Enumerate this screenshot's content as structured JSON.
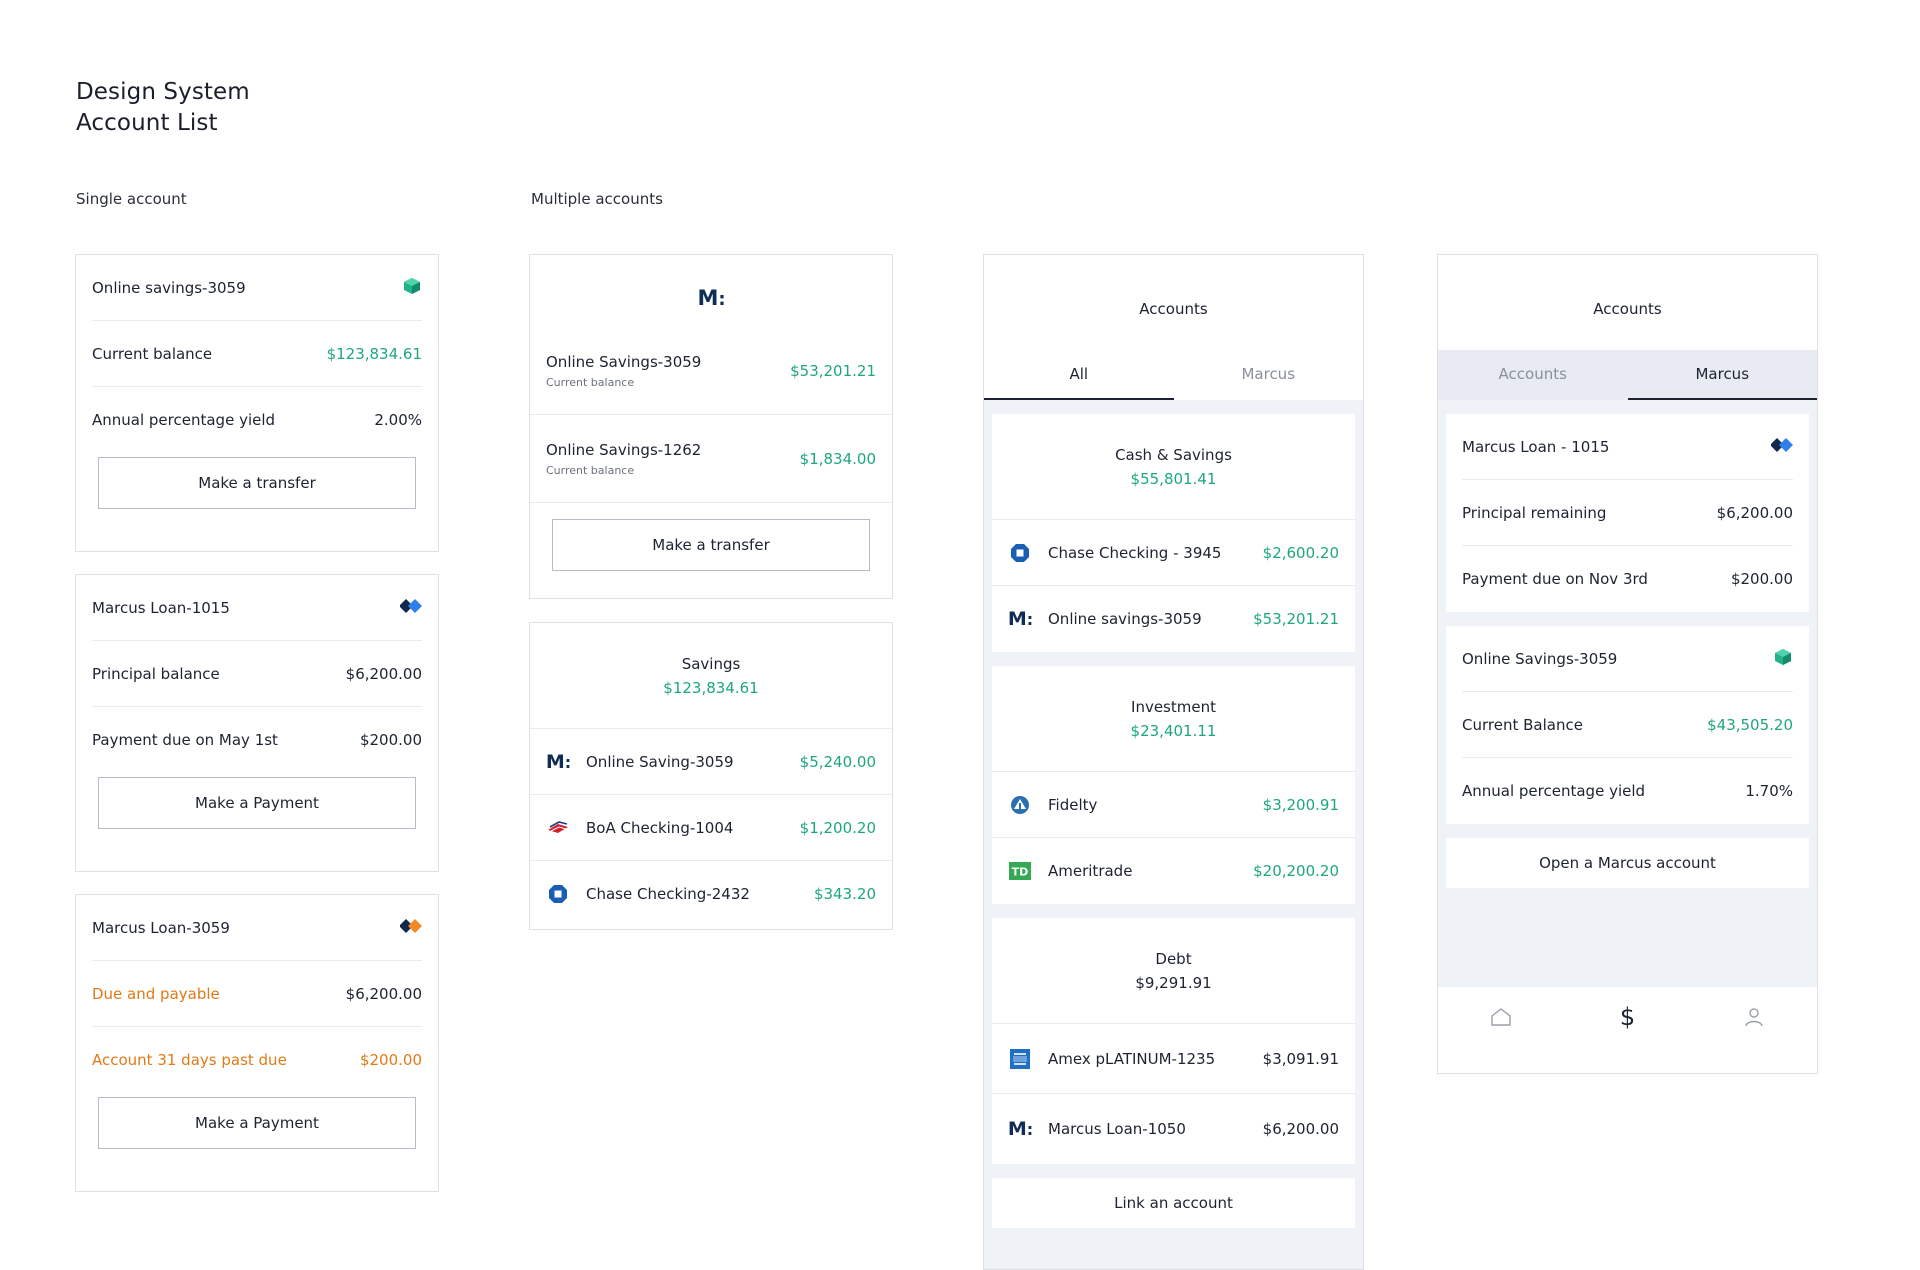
{
  "title": {
    "line1": "Design System",
    "line2": "Account List"
  },
  "sections": {
    "single": "Single account",
    "multiple": "Multiple accounts"
  },
  "colors": {
    "green": "#1ea77f",
    "orange": "#e07a16",
    "navy": "#0f2d55",
    "border": "#dde0e4",
    "panel_bg": "#eff2f6"
  },
  "single": {
    "card1": {
      "title": "Online savings-3059",
      "icon": "marcus-cube-icon",
      "rows": [
        {
          "label": "Current balance",
          "value": "$123,834.61"
        },
        {
          "label": "Annual percentage yield",
          "value": "2.00%"
        }
      ],
      "button": "Make a transfer"
    },
    "card2": {
      "title": "Marcus Loan-1015",
      "icon": "marcus-diamond-icon",
      "rows": [
        {
          "label": "Principal balance",
          "value": "$6,200.00"
        },
        {
          "label": "Payment due on May 1st",
          "value": "$200.00"
        }
      ],
      "button": "Make a Payment"
    },
    "card3": {
      "title": "Marcus Loan-3059",
      "icon": "marcus-diamond-orange-icon",
      "rows": [
        {
          "label": "Due and payable",
          "value": "$6,200.00"
        },
        {
          "label": "Account 31 days past due",
          "value": "$200.00"
        }
      ],
      "button": "Make a Payment"
    }
  },
  "multi": {
    "card1": {
      "logo_letter": "M",
      "logo_colon": ":",
      "accounts": [
        {
          "name": "Online Savings-3059",
          "sub": "Current balance",
          "value": "$53,201.21"
        },
        {
          "name": "Online Savings-1262",
          "sub": "Current balance",
          "value": "$1,834.00"
        }
      ],
      "button": "Make a transfer"
    },
    "card2": {
      "group_title": "Savings",
      "group_value": "$123,834.61",
      "accounts": [
        {
          "name": "Online Saving-3059",
          "value": "$5,240.00",
          "icon": "marcus-m-icon"
        },
        {
          "name": "BoA Checking-1004",
          "value": "$1,200.20",
          "icon": "boa-flag-icon"
        },
        {
          "name": "Chase Checking-2432",
          "value": "$343.20",
          "icon": "chase-octagon-icon"
        }
      ]
    }
  },
  "phone1": {
    "header": "Accounts",
    "tabs": [
      "All",
      "Marcus"
    ],
    "groups": [
      {
        "title": "Cash & Savings",
        "value": "$55,801.41",
        "accounts": [
          {
            "name": "Chase Checking - 3945",
            "value": "$2,600.20",
            "icon": "chase-octagon-icon"
          },
          {
            "name": "Online savings-3059",
            "value": "$53,201.21",
            "icon": "marcus-m-icon"
          }
        ]
      },
      {
        "title": "Investment",
        "value": "$23,401.11",
        "accounts": [
          {
            "name": "Fidelty",
            "value": "$3,200.91",
            "icon": "fidelity-icon"
          },
          {
            "name": "Ameritrade",
            "value": "$20,200.20",
            "icon": "td-icon"
          }
        ]
      },
      {
        "title": "Debt",
        "value": "$9,291.91",
        "accounts": [
          {
            "name": "Amex pLATINUM-1235",
            "value": "$3,091.91",
            "icon": "amex-icon"
          },
          {
            "name": "Marcus Loan-1050",
            "value": "$6,200.00",
            "icon": "marcus-m-icon"
          }
        ]
      }
    ],
    "link_button": "Link an account"
  },
  "phone2": {
    "header": "Accounts",
    "tabs": [
      "Accounts",
      "Marcus"
    ],
    "card1": {
      "title": "Marcus Loan - 1015",
      "rows": [
        {
          "label": "Principal remaining",
          "value": "$6,200.00"
        },
        {
          "label": "Payment due on Nov 3rd",
          "value": "$200.00"
        }
      ]
    },
    "card2": {
      "title": "Online Savings-3059",
      "rows": [
        {
          "label": "Current Balance",
          "value": "$43,505.20"
        },
        {
          "label": "Annual percentage yield",
          "value": "1.70%"
        }
      ]
    },
    "open_button": "Open a Marcus account",
    "nav": {
      "home_icon": "home-icon",
      "dollar": "$",
      "profile_icon": "user-icon"
    }
  }
}
